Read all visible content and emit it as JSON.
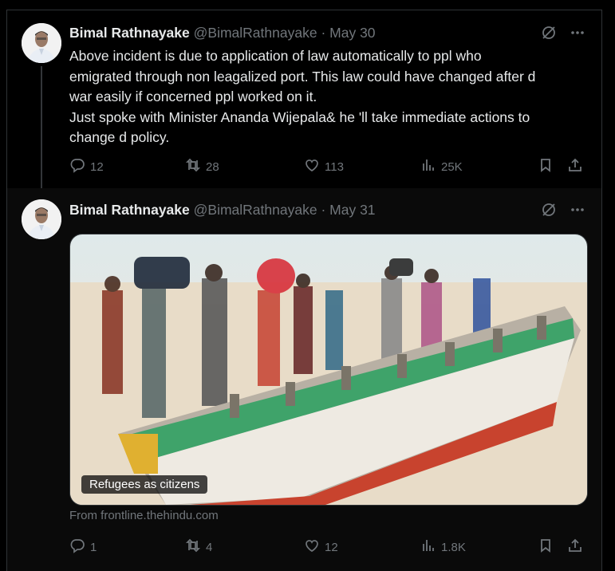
{
  "tweets": [
    {
      "author": "Bimal Rathnayake",
      "handle": "@BimalRathnayake",
      "separator": "·",
      "date": "May 30",
      "text": "Above incident is due to application of law automatically to ppl who\nemigrated through non leagalized port. This law could have changed after d\nwar easily if concerned ppl worked on it.\nJust spoke with Minister Ananda Wijepala& he 'll take immediate actions to\nchange d policy.",
      "replies": "12",
      "reposts": "28",
      "likes": "113",
      "views": "25K"
    },
    {
      "author": "Bimal Rathnayake",
      "handle": "@BimalRathnayake",
      "separator": "·",
      "date": "May 31",
      "media_caption": "Refugees as citizens",
      "source": "From frontline.thehindu.com",
      "replies": "1",
      "reposts": "4",
      "likes": "12",
      "views": "1.8K"
    }
  ],
  "icons": [
    "grok-icon",
    "more-icon",
    "reply-icon",
    "repost-icon",
    "like-icon",
    "views-icon",
    "bookmark-icon",
    "share-icon"
  ],
  "colors": {
    "background": "#000000",
    "text": "#e7e9ea",
    "muted": "#71767b",
    "divider": "#2f3336"
  }
}
